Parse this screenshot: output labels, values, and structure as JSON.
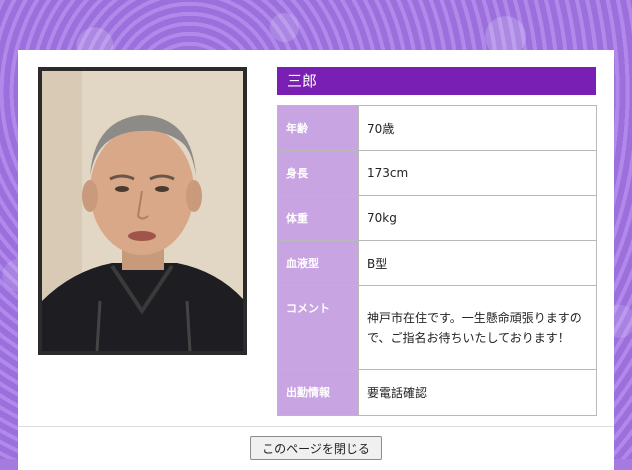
{
  "profile": {
    "name": "三郎",
    "rows": [
      {
        "key": "年齢",
        "value": "70歳"
      },
      {
        "key": "身長",
        "value": "173cm"
      },
      {
        "key": "体重",
        "value": "70kg"
      },
      {
        "key": "血液型",
        "value": "B型"
      },
      {
        "key": "コメント",
        "value": "神戸市在住です。一生懸命頑張りますので、ご指名お待ちいたしております！"
      },
      {
        "key": "出勤情報",
        "value": "要電話確認"
      }
    ]
  },
  "actions": {
    "close_label": "このページを閉じる"
  },
  "colors": {
    "accent": "#7a1fb4",
    "label_bg": "#c9a4e2",
    "background": "#a57be0"
  }
}
